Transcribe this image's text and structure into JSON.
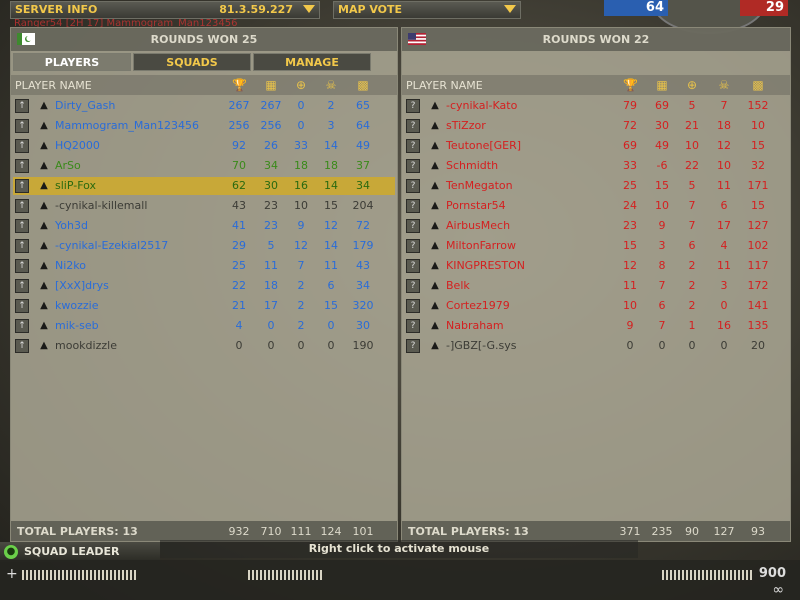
{
  "server": {
    "label": "SERVER INFO",
    "ip": "81.3.59.227"
  },
  "map_vote": {
    "label": "MAP VOTE"
  },
  "killfeed": "Ranger54 [2H 17] Mammogram_Man123456",
  "team_scores": {
    "blue": "64",
    "red": "29"
  },
  "left_team": {
    "rounds_won": "ROUNDS WON 25",
    "tabs": [
      "PLAYERS",
      "SQUADS",
      "MANAGE"
    ],
    "col_player": "PLAYER NAME",
    "players": [
      {
        "name": "Dirty_Gash",
        "c": "blue",
        "v": [
          "267",
          "267",
          "0",
          "2",
          "65"
        ],
        "rank": "↑"
      },
      {
        "name": "Mammogram_Man123456",
        "c": "blue",
        "v": [
          "256",
          "256",
          "0",
          "3",
          "64"
        ],
        "rank": "↑"
      },
      {
        "name": "HQ2000",
        "c": "blue",
        "v": [
          "92",
          "26",
          "33",
          "14",
          "49"
        ],
        "rank": "↑"
      },
      {
        "name": "ArSo",
        "c": "green",
        "v": [
          "70",
          "34",
          "18",
          "18",
          "37"
        ],
        "rank": "↑"
      },
      {
        "name": "sliP-Fox",
        "c": "green",
        "v": [
          "62",
          "30",
          "16",
          "14",
          "34"
        ],
        "rank": "↑",
        "hl": true
      },
      {
        "name": "-cynikal-killemall",
        "c": "grey",
        "v": [
          "43",
          "23",
          "10",
          "15",
          "204"
        ],
        "rank": "↑"
      },
      {
        "name": "Yoh3d",
        "c": "blue",
        "v": [
          "41",
          "23",
          "9",
          "12",
          "72"
        ],
        "rank": "↑"
      },
      {
        "name": "-cynikal-Ezekial2517",
        "c": "blue",
        "v": [
          "29",
          "5",
          "12",
          "14",
          "179"
        ],
        "rank": "↑"
      },
      {
        "name": "Ni2ko",
        "c": "blue",
        "v": [
          "25",
          "11",
          "7",
          "11",
          "43"
        ],
        "rank": "↑"
      },
      {
        "name": "[XxX]drys",
        "c": "blue",
        "v": [
          "22",
          "18",
          "2",
          "6",
          "34"
        ],
        "rank": "↑"
      },
      {
        "name": "kwozzie",
        "c": "blue",
        "v": [
          "21",
          "17",
          "2",
          "15",
          "320"
        ],
        "rank": "↑"
      },
      {
        "name": "mik-seb",
        "c": "blue",
        "v": [
          "4",
          "0",
          "2",
          "0",
          "30"
        ],
        "rank": "↑"
      },
      {
        "name": "mookdizzle",
        "c": "grey",
        "v": [
          "0",
          "0",
          "0",
          "0",
          "190"
        ],
        "rank": "↑"
      }
    ],
    "total_label": "TOTAL PLAYERS: 13",
    "totals": [
      "932",
      "710",
      "111",
      "124",
      "101"
    ]
  },
  "right_team": {
    "rounds_won": "ROUNDS WON 22",
    "col_player": "PLAYER NAME",
    "players": [
      {
        "name": "-cynikal-Kato",
        "c": "red",
        "v": [
          "79",
          "69",
          "5",
          "7",
          "152"
        ],
        "rank": "?"
      },
      {
        "name": "sTiZzor",
        "c": "red",
        "v": [
          "72",
          "30",
          "21",
          "18",
          "10"
        ],
        "rank": "?"
      },
      {
        "name": "Teutone[GER]",
        "c": "red",
        "v": [
          "69",
          "49",
          "10",
          "12",
          "15"
        ],
        "rank": "?"
      },
      {
        "name": "Schmidth",
        "c": "red",
        "v": [
          "33",
          "-6",
          "22",
          "10",
          "32"
        ],
        "rank": "?"
      },
      {
        "name": "TenMegaton",
        "c": "red",
        "v": [
          "25",
          "15",
          "5",
          "11",
          "171"
        ],
        "rank": "?"
      },
      {
        "name": "Pornstar54",
        "c": "red",
        "v": [
          "24",
          "10",
          "7",
          "6",
          "15"
        ],
        "rank": "?"
      },
      {
        "name": "AirbusMech",
        "c": "red",
        "v": [
          "23",
          "9",
          "7",
          "17",
          "127"
        ],
        "rank": "?"
      },
      {
        "name": "MiltonFarrow",
        "c": "red",
        "v": [
          "15",
          "3",
          "6",
          "4",
          "102"
        ],
        "rank": "?"
      },
      {
        "name": "KINGPRESTON",
        "c": "red",
        "v": [
          "12",
          "8",
          "2",
          "11",
          "117"
        ],
        "rank": "?"
      },
      {
        "name": "Belk",
        "c": "red",
        "v": [
          "11",
          "7",
          "2",
          "3",
          "172"
        ],
        "rank": "?"
      },
      {
        "name": "Cortez1979",
        "c": "red",
        "v": [
          "10",
          "6",
          "2",
          "0",
          "141"
        ],
        "rank": "?"
      },
      {
        "name": "Nabraham",
        "c": "red",
        "v": [
          "9",
          "7",
          "1",
          "16",
          "135"
        ],
        "rank": "?"
      },
      {
        "name": "-]GBZ[-G.sys",
        "c": "grey",
        "v": [
          "0",
          "0",
          "0",
          "0",
          "20"
        ],
        "rank": "?"
      }
    ],
    "total_label": "TOTAL PLAYERS: 13",
    "totals": [
      "371",
      "235",
      "90",
      "127",
      "93"
    ]
  },
  "hud": {
    "squad_leader": "SQUAD LEADER",
    "tip": "Right click to activate mouse",
    "ammo": "900"
  },
  "colors": {
    "blue_team": "#2a5fb0",
    "red_team": "#b02a25",
    "accent": "#f2c84a",
    "highlight_row": "#c8a838"
  },
  "icons": [
    "trophy-icon",
    "teamwork-icon",
    "crosshair-kills-icon",
    "skull-deaths-icon",
    "ping-bars-icon"
  ]
}
